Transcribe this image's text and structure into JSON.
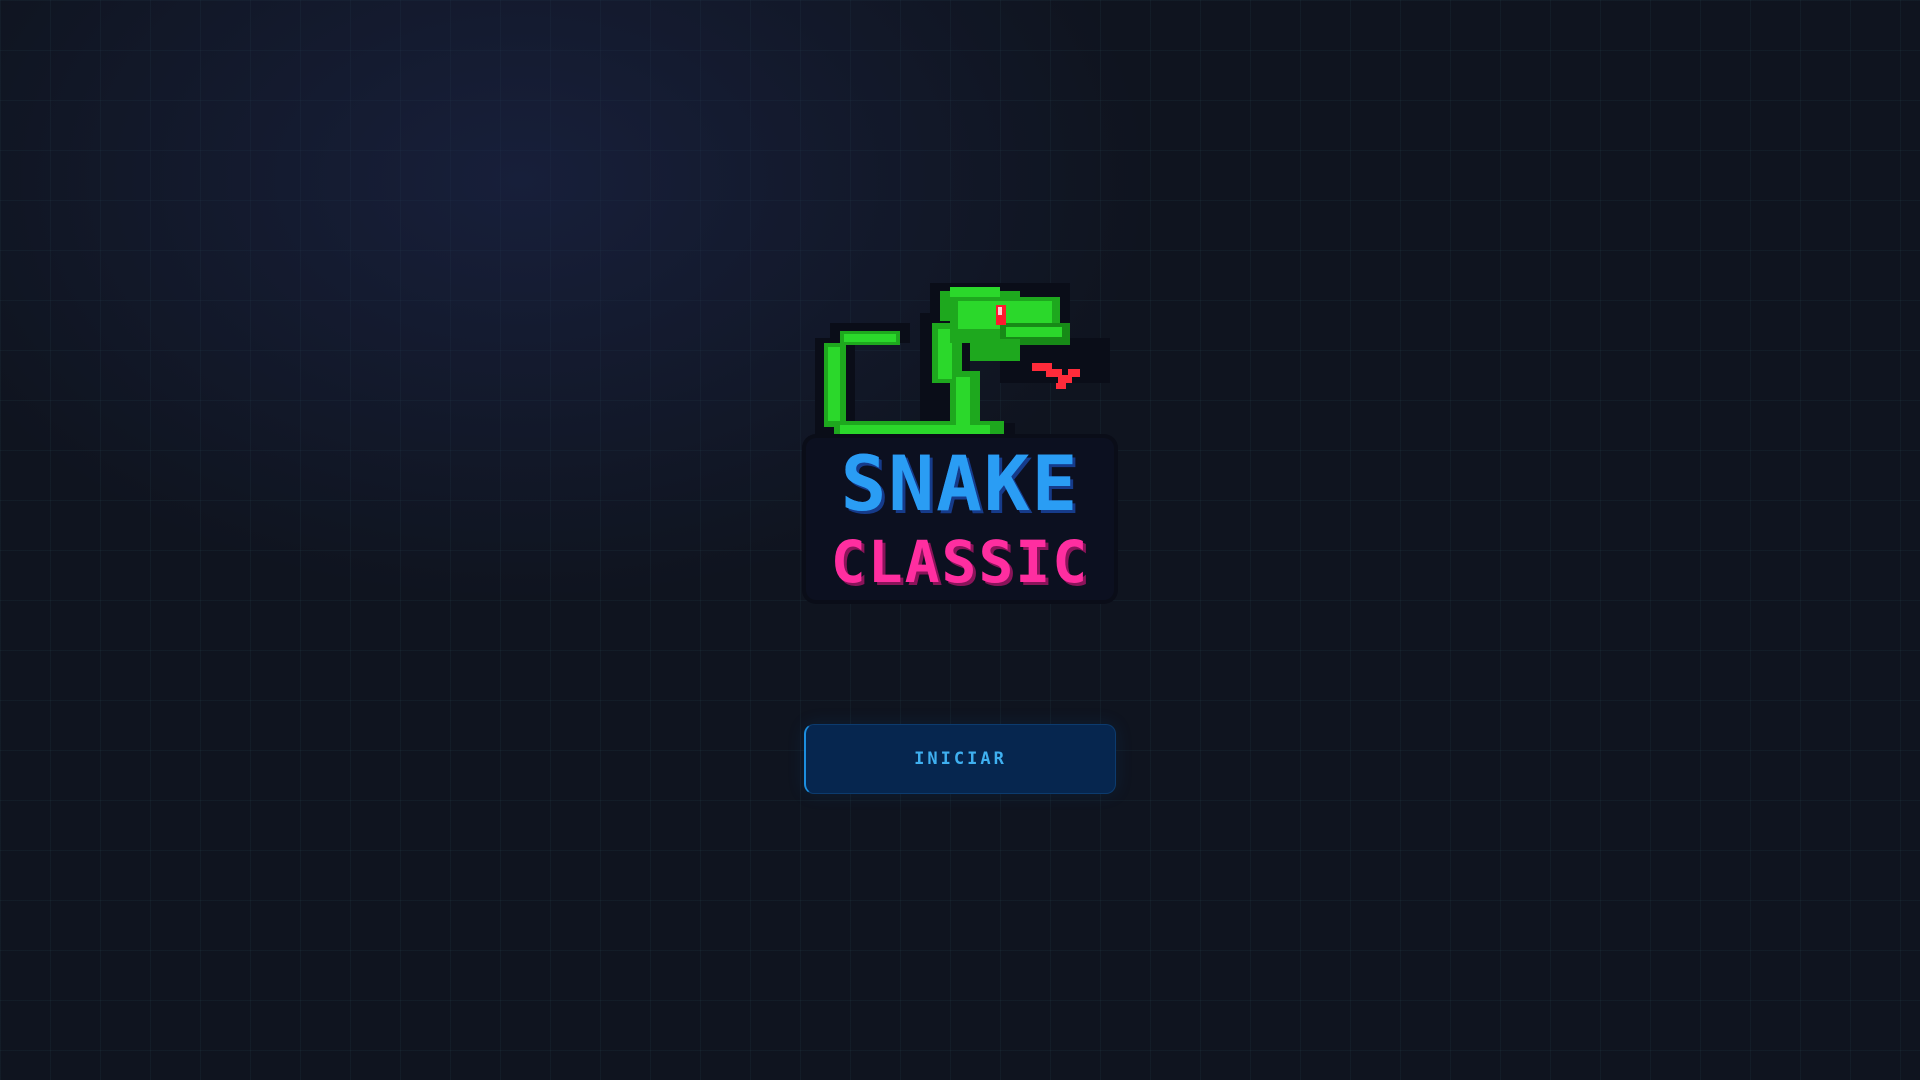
{
  "logo": {
    "icon": "snake-icon",
    "title_line1": "SNAKE",
    "title_line2": "CLASSIC",
    "colors": {
      "snake_green": "#2bd82b",
      "snake_eye": "#ff1a2e",
      "tongue": "#ff2b3a",
      "title_line1": "#2a9df4",
      "title_line2": "#ff2ea0"
    }
  },
  "start_button": {
    "label": "INICIAR",
    "background": "#06264f",
    "text_color": "#3fb0f0"
  },
  "background": {
    "color": "#0f141f",
    "grid": true
  }
}
